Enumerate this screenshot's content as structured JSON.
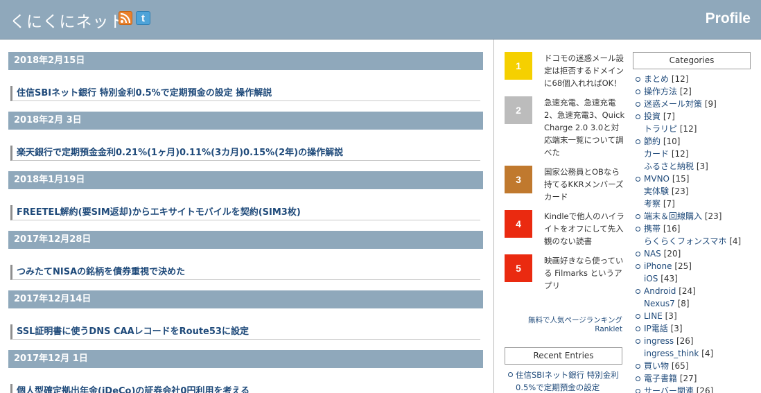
{
  "header": {
    "title": "くにくにネット",
    "profile": "Profile"
  },
  "entries": [
    {
      "date": "2018年2月15日",
      "title": "住信SBIネット銀行 特別金利0.5%で定期預金の設定 操作解説"
    },
    {
      "date": "2018年2月 3日",
      "title": "楽天銀行で定期預金金利0.21%(1ヶ月)0.11%(3カ月)0.15%(2年)の操作解説"
    },
    {
      "date": "2018年1月19日",
      "title": "FREETEL解約(要SIM返却)からエキサイトモバイルを契約(SIM3枚)"
    },
    {
      "date": "2017年12月28日",
      "title": "つみたてNISAの銘柄を債券重視で決めた"
    },
    {
      "date": "2017年12月14日",
      "title": "SSL証明書に使うDNS CAAレコードをRoute53に設定"
    },
    {
      "date": "2017年12月 1日",
      "title": "個人型確定拠出年金(iDeCo)の証券会社0円利用を考える"
    }
  ],
  "ranking": {
    "items": [
      {
        "rank": "1",
        "color": "#f5d000",
        "text": "ドコモの迷惑メール設定は拒否するドメインに68個入れればOK！"
      },
      {
        "rank": "2",
        "color": "#bcbcbc",
        "text": "急速充電、急速充電2、急速充電3、Quick Charge 2.0 3.0と対応端末一覧について調べた"
      },
      {
        "rank": "3",
        "color": "#c0792e",
        "text": "国家公務員とOBなら持てるKKRメンバーズカード"
      },
      {
        "rank": "4",
        "color": "#ea2a10",
        "text": "Kindleで他人のハイライトをオフにして先入観のない読書"
      },
      {
        "rank": "5",
        "color": "#ea2a10",
        "text": "映画好きなら使っている Filmarks というアプリ"
      }
    ],
    "footer_line1": "無料で人気ページランキング",
    "footer_line2": "Ranklet"
  },
  "recent_entries": {
    "title": "Recent Entries",
    "items": [
      "住信SBIネット銀行 特別金利0.5%で定期預金の設定"
    ]
  },
  "categories": {
    "title": "Categories",
    "items": [
      {
        "name": "まとめ",
        "count": "[12]",
        "level": 0
      },
      {
        "name": "操作方法",
        "count": "[2]",
        "level": 0
      },
      {
        "name": "迷惑メール対策",
        "count": "[9]",
        "level": 0
      },
      {
        "name": "投資",
        "count": "[7]",
        "level": 0
      },
      {
        "name": "トラリピ",
        "count": "[12]",
        "level": 1
      },
      {
        "name": "節約",
        "count": "[10]",
        "level": 0
      },
      {
        "name": "カード",
        "count": "[12]",
        "level": 1
      },
      {
        "name": "ふるさと納税",
        "count": "[3]",
        "level": 1
      },
      {
        "name": "MVNO",
        "count": "[15]",
        "level": 0
      },
      {
        "name": "実体験",
        "count": "[23]",
        "level": 1
      },
      {
        "name": "考察",
        "count": "[7]",
        "level": 1
      },
      {
        "name": "端末＆回線購入",
        "count": "[23]",
        "level": 0
      },
      {
        "name": "携帯",
        "count": "[16]",
        "level": 0
      },
      {
        "name": "らくらくフォンスマホ",
        "count": "[4]",
        "level": 1
      },
      {
        "name": "NAS",
        "count": "[20]",
        "level": 0
      },
      {
        "name": "iPhone",
        "count": "[25]",
        "level": 0
      },
      {
        "name": "iOS",
        "count": "[43]",
        "level": 1
      },
      {
        "name": "Android",
        "count": "[24]",
        "level": 0
      },
      {
        "name": "Nexus7",
        "count": "[8]",
        "level": 1
      },
      {
        "name": "LINE",
        "count": "[3]",
        "level": 0
      },
      {
        "name": "IP電話",
        "count": "[3]",
        "level": 0
      },
      {
        "name": "ingress",
        "count": "[26]",
        "level": 0
      },
      {
        "name": "ingress_think",
        "count": "[4]",
        "level": 1
      },
      {
        "name": "買い物",
        "count": "[65]",
        "level": 0
      },
      {
        "name": "電子書籍",
        "count": "[27]",
        "level": 0
      },
      {
        "name": "サーバー関連",
        "count": "[26]",
        "level": 0
      }
    ]
  }
}
